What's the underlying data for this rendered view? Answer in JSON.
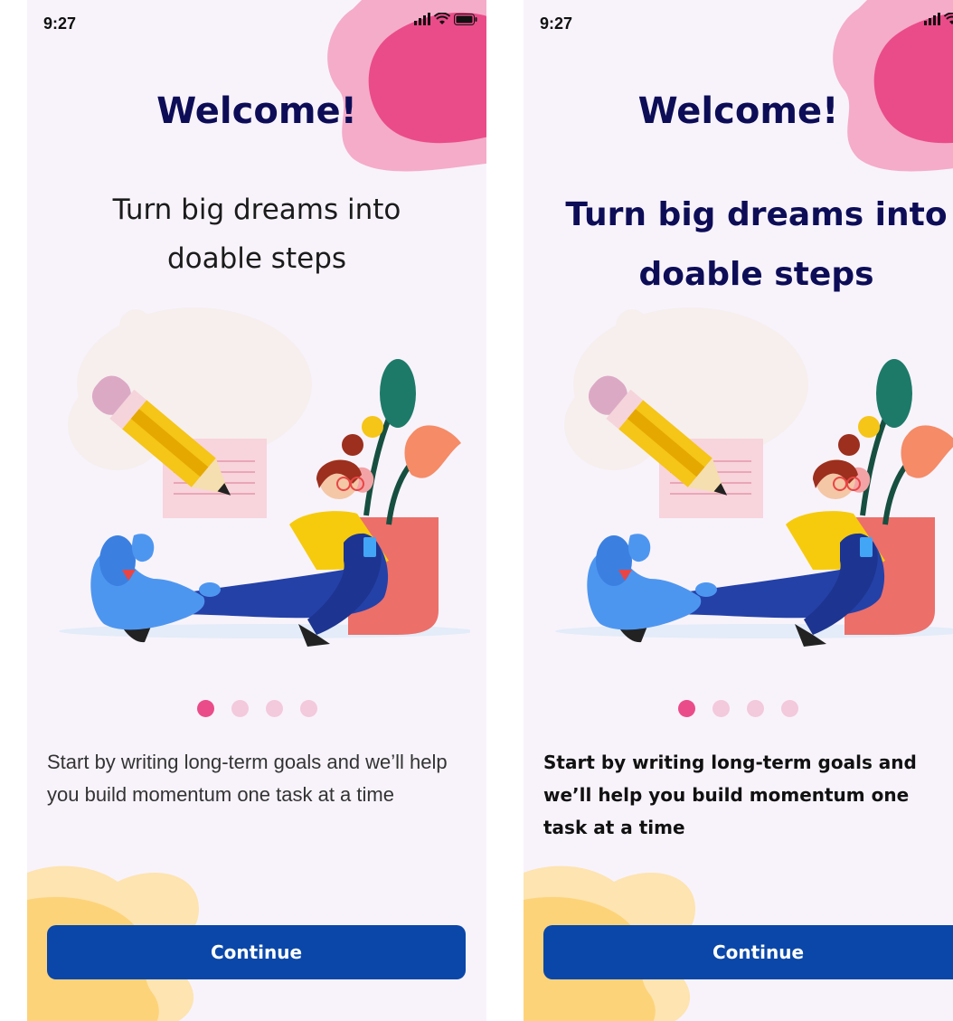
{
  "status_bar": {
    "time": "9:27"
  },
  "onboarding": {
    "title": "Welcome!",
    "subtitle": "Turn big dreams into doable steps",
    "description": "Start by writing long-term goals and we’ll help you build momentum one task at a time",
    "continue_label": "Continue",
    "pagination": {
      "total": 4,
      "active_index": 0
    }
  },
  "colors": {
    "background": "#f8f3fb",
    "title": "#0d0d57",
    "button": "#0a47a8",
    "dot_active": "#ea4c89",
    "dot_inactive": "#f3c9dc",
    "blob_pink": "#f4acc9",
    "blob_magenta": "#ea4c89",
    "blob_yellow": "#fdd37a"
  }
}
